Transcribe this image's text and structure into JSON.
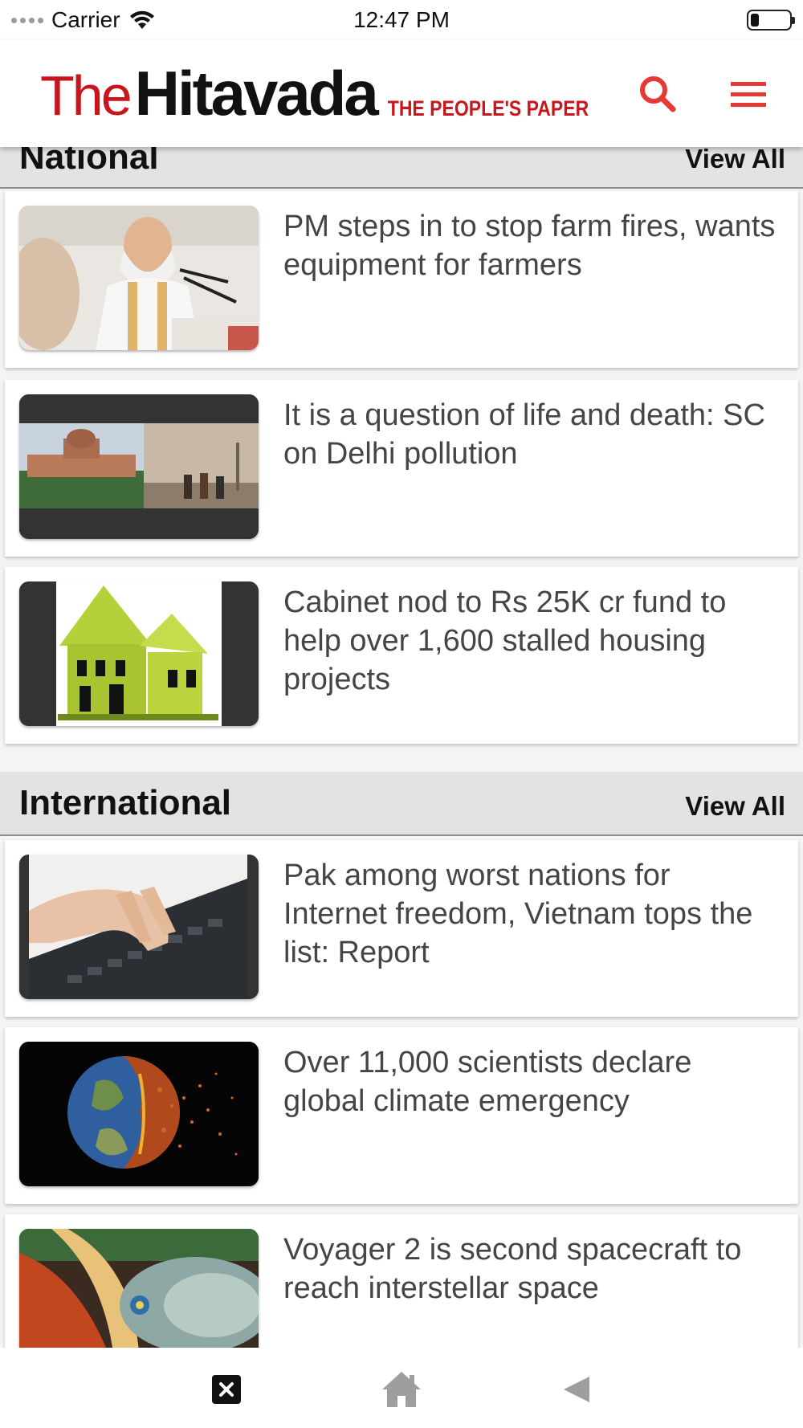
{
  "status_bar": {
    "carrier": "Carrier",
    "time": "12:47 PM",
    "battery_level": 0.2
  },
  "header": {
    "logo_the": "The",
    "logo_name": "Hitavada",
    "logo_tagline": "THE PEOPLE'S PAPER",
    "search_icon": "search-icon",
    "menu_icon": "hamburger-menu-icon",
    "accent_color": "#e53935"
  },
  "sections": [
    {
      "title": "National",
      "view_all": "View All",
      "articles": [
        {
          "headline": "PM steps in to stop farm fires, wants equipment for farmers"
        },
        {
          "headline": "It is a question of life and death: SC on Delhi pollution"
        },
        {
          "headline": "Cabinet nod to Rs 25K cr fund to help over 1,600 stalled housing projects"
        }
      ]
    },
    {
      "title": "International",
      "view_all": "View All",
      "articles": [
        {
          "headline": "Pak among worst nations for Internet freedom, Vietnam tops the list: Report"
        },
        {
          "headline": "Over 11,000 scientists declare global climate emergency"
        },
        {
          "headline": "Voyager 2 is second spacecraft to reach interstellar space"
        }
      ]
    }
  ],
  "bottom_bar": {
    "close_icon": "close-icon",
    "home_icon": "home-icon",
    "back_icon": "back-icon"
  }
}
